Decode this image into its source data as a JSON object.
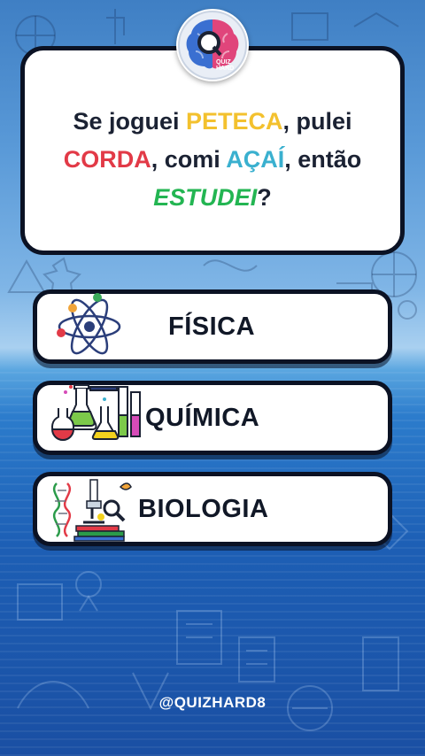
{
  "logo": {
    "text_line1": "QUIZ",
    "text_line2": "HARD",
    "letter": "Q"
  },
  "question": {
    "part1": "Se joguei ",
    "word1": "PETECA",
    "part2": ", pulei ",
    "word2": "CORDA",
    "part3": ", comi ",
    "word3": "AÇAÍ",
    "part4": ", então ",
    "word4": "ESTUDEI",
    "part5": "?"
  },
  "answers": [
    {
      "label": "FÍSICA",
      "icon": "atom-icon"
    },
    {
      "label": "QUÍMICA",
      "icon": "lab-flasks-icon"
    },
    {
      "label": "BIOLOGIA",
      "icon": "microscope-dna-icon"
    }
  ],
  "footer": {
    "handle": "@QUIZHARD8"
  },
  "colors": {
    "peteca": "#f3c12e",
    "corda": "#e23a47",
    "acai": "#3ab0cf",
    "estudei": "#23b552",
    "border": "#0b1224"
  }
}
